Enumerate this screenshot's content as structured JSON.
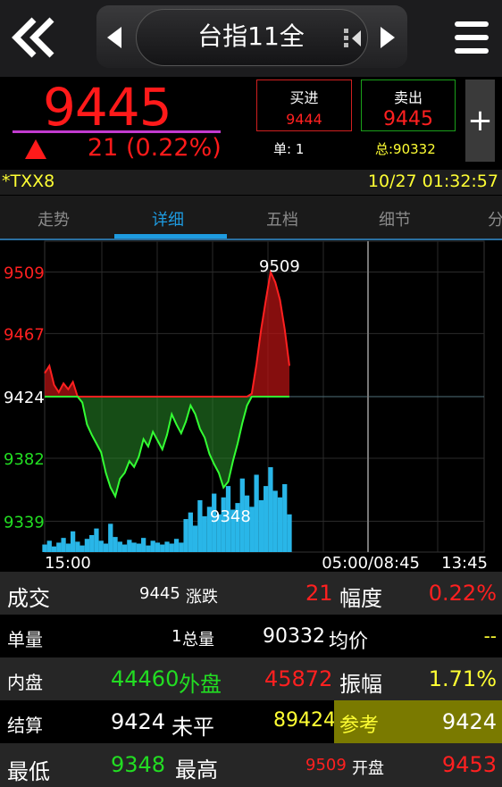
{
  "header": {
    "title": "台指11全",
    "back_icon": "double-chevron-left-icon",
    "prev_icon": "triangle-left-icon",
    "next_icon": "triangle-right-icon",
    "pager_icon": "pager-icon",
    "menu_icon": "hamburger-menu-icon"
  },
  "quote": {
    "last": "9445",
    "change": "21",
    "change_pct": "(0.22%)",
    "buy_label": "买进",
    "buy_price": "9444",
    "sell_label": "卖出",
    "sell_price": "9445",
    "single_text": "单: 1",
    "total_text": "总:90332",
    "plus_label": "+"
  },
  "symbol": {
    "code": "*TXX8",
    "datetime": "10/27 01:32:57"
  },
  "tabs": [
    "走势",
    "详细",
    "五档",
    "细节",
    "分"
  ],
  "active_tab": 1,
  "chart_data": {
    "type": "line",
    "y_ticks": [
      "9509",
      "9467",
      "9424",
      "9382",
      "9339"
    ],
    "reference": 9424,
    "ylim": [
      9318,
      9530
    ],
    "x_ticks": [
      "15:00",
      "05:00/08:45",
      "13:45"
    ],
    "high_label": "9509",
    "low_label": "9348",
    "price": [
      9440,
      9445,
      9432,
      9427,
      9433,
      9429,
      9434,
      9424,
      9420,
      9405,
      9398,
      9392,
      9386,
      9372,
      9362,
      9356,
      9368,
      9372,
      9380,
      9376,
      9383,
      9395,
      9390,
      9400,
      9394,
      9388,
      9398,
      9412,
      9405,
      9399,
      9407,
      9418,
      9412,
      9402,
      9396,
      9385,
      9378,
      9372,
      9362,
      9366,
      9380,
      9392,
      9406,
      9418,
      9426,
      9446,
      9470,
      9490,
      9509,
      9502,
      9490,
      9470,
      9445
    ],
    "volume": [
      8,
      12,
      6,
      10,
      15,
      9,
      22,
      11,
      7,
      14,
      18,
      25,
      12,
      9,
      30,
      16,
      11,
      8,
      13,
      10,
      9,
      15,
      7,
      12,
      10,
      8,
      11,
      9,
      14,
      10,
      35,
      42,
      28,
      55,
      38,
      48,
      62,
      40,
      58,
      70,
      45,
      52,
      78,
      60,
      48,
      82,
      55,
      70,
      90,
      65,
      58,
      72,
      40
    ]
  },
  "table": {
    "r1": {
      "l1": "成交",
      "v1": "9445",
      "l2": "涨跌",
      "v2": "21",
      "l3": "幅度",
      "v3": "0.22%"
    },
    "r2": {
      "l1": "单量",
      "v1": "1",
      "l2": "总量",
      "v2": "90332",
      "l3": "均价",
      "v3": "--"
    },
    "r3": {
      "l1": "内盘",
      "v1": "44460",
      "l2": "外盘",
      "v2": "45872",
      "l3": "振幅",
      "v3": "1.71%"
    },
    "r4": {
      "l1": "结算",
      "v1": "9424",
      "l2": "未平",
      "v2": "89424",
      "l3": "参考",
      "v3": "9424"
    },
    "r5": {
      "l1": "最低",
      "v1": "9348",
      "l2": "最高",
      "v2": "9509",
      "l3": "开盘",
      "v3": "9453"
    }
  },
  "colors": {
    "up": "#ff1a1a",
    "down": "#22dd22",
    "accent": "#1e9be0",
    "yellow": "#ffff33"
  }
}
